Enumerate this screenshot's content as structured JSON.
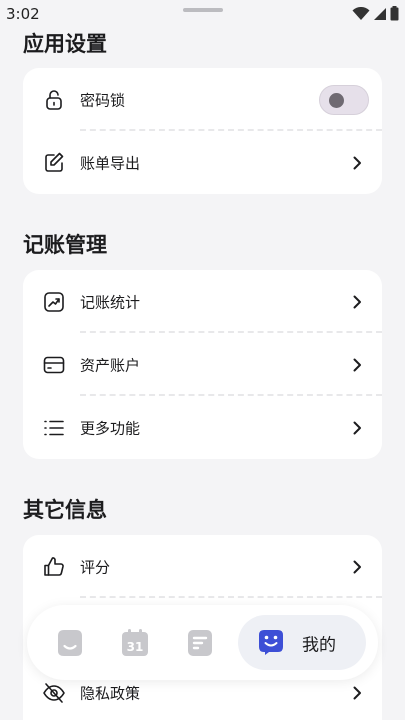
{
  "status_bar": {
    "time": "3:02"
  },
  "sections": {
    "app_settings": {
      "title": "应用设置",
      "items": [
        {
          "label": "密码锁",
          "icon": "lock-icon",
          "control": "toggle",
          "toggle_on": false
        },
        {
          "label": "账单导出",
          "icon": "edit-icon",
          "control": "chevron"
        }
      ]
    },
    "bookkeeping": {
      "title": "记账管理",
      "items": [
        {
          "label": "记账统计",
          "icon": "chart-icon",
          "control": "chevron"
        },
        {
          "label": "资产账户",
          "icon": "card-icon",
          "control": "chevron"
        },
        {
          "label": "更多功能",
          "icon": "list-icon",
          "control": "chevron"
        }
      ]
    },
    "other_info": {
      "title": "其它信息",
      "items": [
        {
          "label": "评分",
          "icon": "thumbs-up-icon",
          "control": "chevron"
        },
        {
          "label": "隐私政策",
          "icon": "eye-off-icon",
          "control": "chevron"
        }
      ]
    }
  },
  "bottom_nav": {
    "items": [
      {
        "icon": "smile-face-icon",
        "active": false
      },
      {
        "icon": "calendar-icon",
        "calendar_day": "31",
        "active": false
      },
      {
        "icon": "document-icon",
        "active": false
      },
      {
        "icon": "mine-face-icon",
        "label": "我的",
        "active": true
      }
    ]
  },
  "colors": {
    "background": "#f4f4f6",
    "card": "#ffffff",
    "accent": "#3d4fd6",
    "inactive_icon": "#c8c8cc"
  }
}
